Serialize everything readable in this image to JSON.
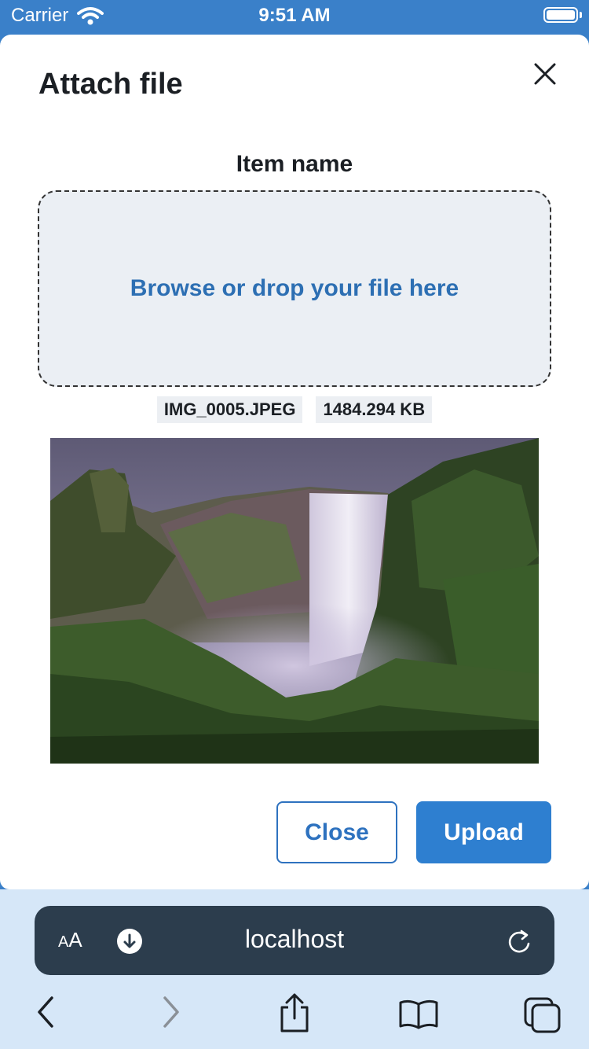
{
  "status_bar": {
    "carrier": "Carrier",
    "time": "9:51 AM"
  },
  "modal": {
    "title": "Attach file",
    "item_name_label": "Item name",
    "dropzone_text": "Browse or drop your file here",
    "file_name": "IMG_0005.JPEG",
    "file_size": "1484.294 KB",
    "preview_image": "waterfall-landscape",
    "close_button": "Close",
    "upload_button": "Upload"
  },
  "browser": {
    "text_size_label_small": "A",
    "text_size_label_large": "A",
    "url": "localhost",
    "icons": [
      "download-icon",
      "reload-icon",
      "back-icon",
      "forward-icon",
      "share-icon",
      "bookmarks-icon",
      "tabs-icon"
    ]
  },
  "colors": {
    "status_bar_bg": "#3a80c9",
    "accent": "#2e7fd0",
    "dropzone_bg": "#ebeff4",
    "url_bar_bg": "#2c3d4d",
    "browser_bg": "#d6e7f8"
  }
}
